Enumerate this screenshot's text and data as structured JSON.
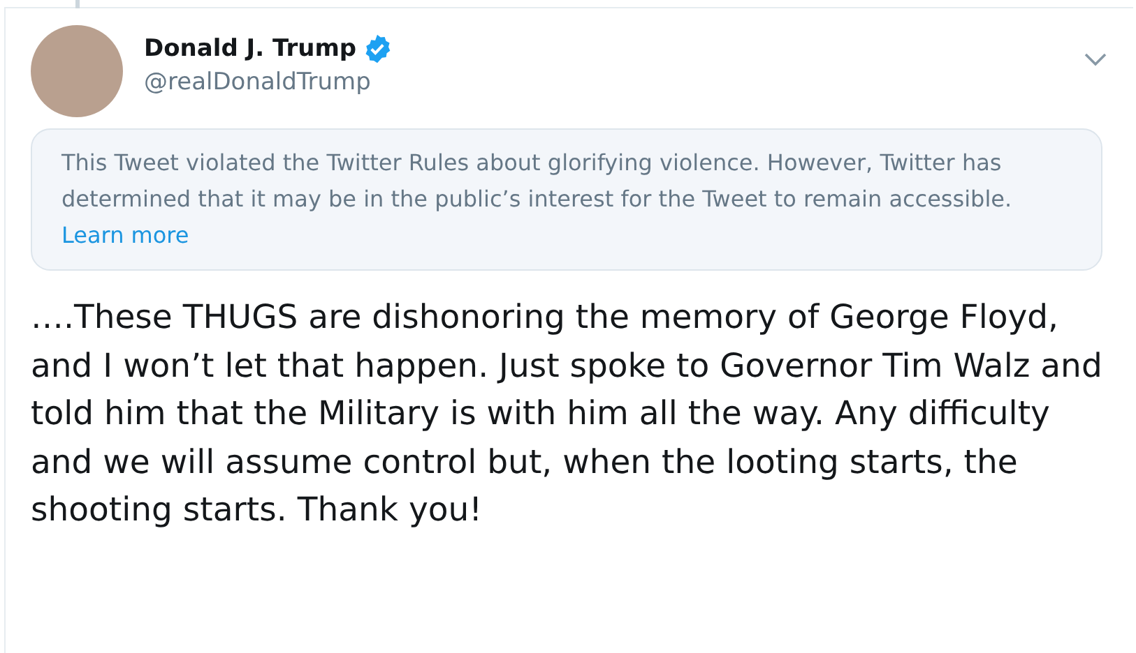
{
  "author": {
    "name": "Donald J. Trump",
    "handle": "@realDonaldTrump",
    "verified": true
  },
  "notice": {
    "text": "This Tweet violated the Twitter Rules about glorifying violence. However, Twitter has determined that it may be in the public’s interest for the Tweet to remain accessible.",
    "link": "Learn more"
  },
  "tweet": {
    "text": "….These THUGS are dishonoring the memory of George Floyd, and I won’t let that happen. Just spoke to Governor Tim Walz and told him that the Military is with him all the way. Any difficulty and we will assume control but, when the looting starts, the shooting starts. Thank you!"
  }
}
